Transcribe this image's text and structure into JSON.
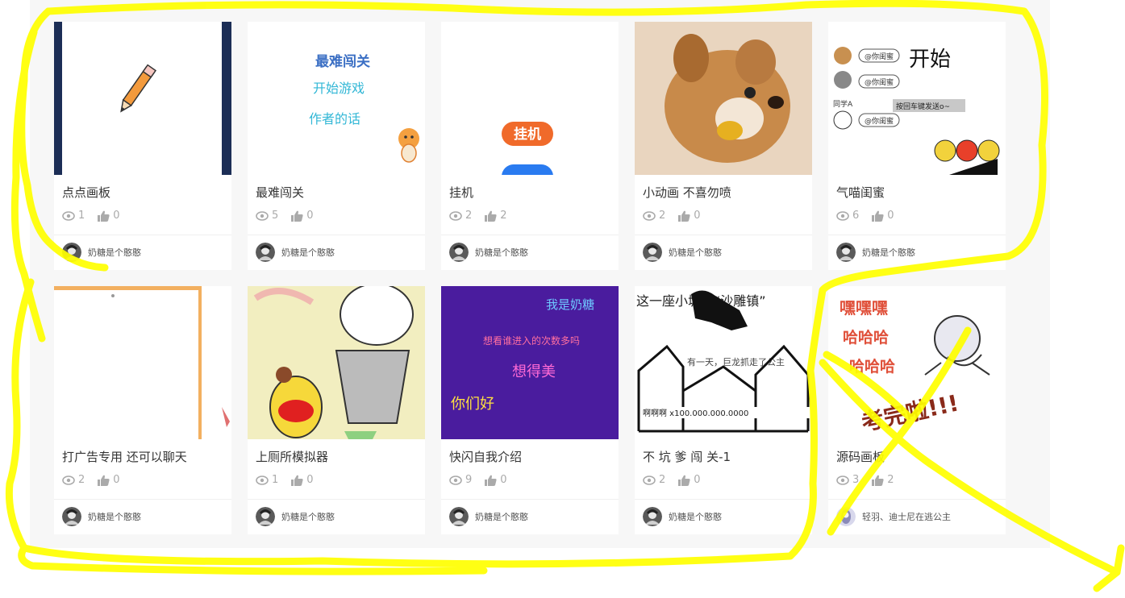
{
  "cards": [
    {
      "title": "点点画板",
      "views": "1",
      "likes": "0",
      "author": "奶糖是个憨憨"
    },
    {
      "title": "最难闯关",
      "views": "5",
      "likes": "0",
      "author": "奶糖是个憨憨",
      "thumb": [
        "最难闯关",
        "开始游戏",
        "作者的话"
      ]
    },
    {
      "title": "挂机",
      "views": "2",
      "likes": "2",
      "author": "奶糖是个憨憨",
      "thumb": [
        "挂机"
      ]
    },
    {
      "title": "小动画 不喜勿喷",
      "views": "2",
      "likes": "0",
      "author": "奶糖是个憨憨"
    },
    {
      "title": "气喵闺蜜",
      "views": "6",
      "likes": "0",
      "author": "奶糖是个憨憨",
      "thumb": [
        "开始",
        "@你闺蜜",
        "@你闺蜜",
        "@你闺蜜",
        "同学A",
        "按回车键发送o~"
      ]
    },
    {
      "title": "打广告专用 还可以聊天",
      "views": "2",
      "likes": "0",
      "author": "奶糖是个憨憨"
    },
    {
      "title": "上厕所模拟器",
      "views": "1",
      "likes": "0",
      "author": "奶糖是个憨憨"
    },
    {
      "title": "快闪自我介绍",
      "views": "9",
      "likes": "0",
      "author": "奶糖是个憨憨",
      "thumb": [
        "我是奶糖",
        "想看谁进入的次数多吗",
        "想得美",
        "你们好"
      ]
    },
    {
      "title": "不 坑 爹 闯 关-1",
      "views": "2",
      "likes": "0",
      "author": "奶糖是个憨憨",
      "thumb": [
        "这一座小城叫“沙雕镇”",
        "有一天，巨龙抓走了公主",
        "啊啊啊 x100.000.000.0000"
      ]
    },
    {
      "title": "源码画板",
      "views": "3",
      "likes": "2",
      "author": "轻羽、迪士尼在逃公主",
      "thumb": [
        "嘿嘿嘿",
        "哈哈哈",
        "哈哈哈",
        "考完啦!!!"
      ]
    }
  ],
  "colors": {
    "highlight": "#ffff00",
    "panel": "#f7f7f7",
    "title": "#333333",
    "meta": "#aaaaaa"
  }
}
